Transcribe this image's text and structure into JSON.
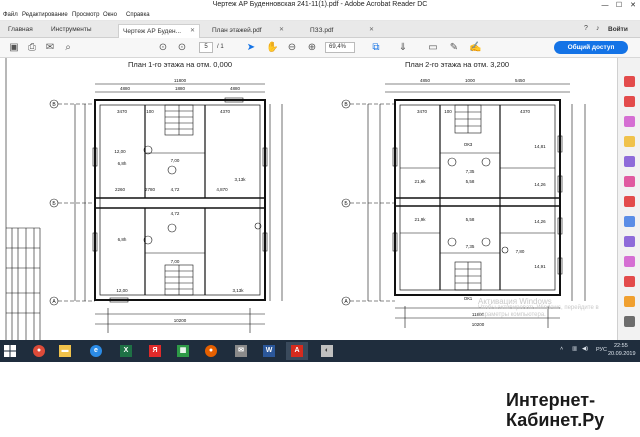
{
  "window": {
    "title": "Чертеж АР Буденновская 241-11(1).pdf - Adobe Acrobat Reader DC",
    "minimize": "—",
    "maximize": "☐",
    "close": "✕"
  },
  "menu": [
    "Файл",
    "Редактирование",
    "Просмотр",
    "Окно",
    "Справка"
  ],
  "tabs": {
    "home": "Главная",
    "tools": "Инструменты",
    "documents": [
      {
        "label": "Чертеж АР Буден...",
        "active": true
      },
      {
        "label": "План этажей.pdf",
        "active": false
      },
      {
        "label": "ПЗЗ.pdf",
        "active": false
      }
    ],
    "close_glyph": "✕",
    "signin": "Войти"
  },
  "toolbar": {
    "page_current": "5",
    "page_total": "/ 1",
    "zoom": "69,4%",
    "share_label": "Общий доступ"
  },
  "document": {
    "plan1_title": "План 1-го этажа на отм. 0,000",
    "plan2_title": "План 2-го этажа на отм. 3,200",
    "plan1": {
      "top_dim": "11800",
      "sub_dims_top": [
        "4880",
        "1880",
        "4880"
      ],
      "room_dims": [
        "3470",
        "100",
        "2350",
        "4370",
        "100"
      ],
      "bottom_dim": "10200",
      "axes_left": [
        "B",
        "Б",
        "А"
      ],
      "labels": [
        "12,00",
        "6,8h",
        "7,00",
        "2780",
        "4,72",
        "4,870",
        "3,13k",
        "2260",
        "100",
        "1,3,k"
      ]
    },
    "plan2": {
      "top_dims": [
        "4850",
        "1000",
        "5450"
      ],
      "room_dims": [
        "3470",
        "100",
        "2350",
        "4370"
      ],
      "bottom_dims": [
        "11800",
        "10200"
      ],
      "axes_left": [
        "B",
        "Б",
        "А"
      ],
      "labels": [
        "14,81",
        "14,26",
        "21,9k",
        "5,58",
        "7,35",
        "14,91",
        "7,80",
        "ОК3",
        "ОК1"
      ]
    }
  },
  "watermark": {
    "line1": "Активация Windows",
    "line2": "Чтобы активировать Windows, перейдите в",
    "line3": "параметры компьютера."
  },
  "taskbar": {
    "apps": [
      {
        "icon": "chrome-icon",
        "glyph": "●",
        "color": "#dd4b39"
      },
      {
        "icon": "folder-icon",
        "glyph": "▬",
        "color": "#f0c24b"
      },
      {
        "icon": "ie-icon",
        "glyph": "e",
        "color": "#2b8be6"
      },
      {
        "icon": "excel-icon",
        "glyph": "X",
        "color": "#1e7145"
      },
      {
        "icon": "yandex-icon",
        "glyph": "Я",
        "color": "#e02a2a"
      },
      {
        "icon": "spreadsheet-icon",
        "glyph": "▦",
        "color": "#2e9a47"
      },
      {
        "icon": "firefox-icon",
        "glyph": "●",
        "color": "#e66000"
      },
      {
        "icon": "mail-icon",
        "glyph": "✉",
        "color": "#8a8a8a"
      },
      {
        "icon": "word-icon",
        "glyph": "W",
        "color": "#2b579a"
      },
      {
        "icon": "acrobat-icon",
        "glyph": "A",
        "color": "#d52b1e"
      },
      {
        "icon": "paint-icon",
        "glyph": "◐",
        "color": "#c0c0c0"
      }
    ],
    "lang": "РУС",
    "time": "22:55",
    "date": "20.09.2019"
  },
  "ad": {
    "line1": "Интернет-",
    "line2": "Кабинет.Ру"
  },
  "colors": {
    "accent": "#1473e6",
    "taskbar": "#1f2d3d"
  }
}
